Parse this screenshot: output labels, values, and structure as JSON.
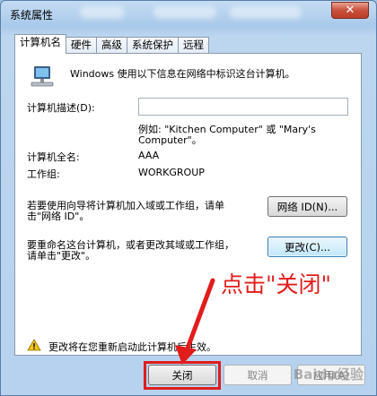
{
  "window": {
    "title": "系统属性",
    "close_glyph": "✕"
  },
  "tabs": [
    {
      "label": "计算机名",
      "active": true
    },
    {
      "label": "硬件"
    },
    {
      "label": "高级"
    },
    {
      "label": "系统保护"
    },
    {
      "label": "远程"
    }
  ],
  "panel": {
    "intro": "Windows 使用以下信息在网络中标识这台计算机。",
    "description_label": "计算机描述(D):",
    "description_value": "",
    "example_line1": "例如: \"Kitchen Computer\" 或 \"Mary's",
    "example_line2": "Computer\"。",
    "full_name_label": "计算机全名:",
    "full_name_value": "AAA",
    "workgroup_label": "工作组:",
    "workgroup_value": "WORKGROUP",
    "network_id_text_1": "若要使用向导将计算机加入域或工作组，请单",
    "network_id_text_2": "击\"网络 ID\"。",
    "network_id_button": "网络 ID(N)...",
    "change_text_1": "要重命名这台计算机，或者更改其域或工作组，",
    "change_text_2": "请单击\"更改\"。",
    "change_button": "更改(C)...",
    "warning_text": "更改将在您重新启动此计算机后生效。"
  },
  "buttons": {
    "close": "关闭",
    "cancel": "取消",
    "apply": "应用(A)"
  },
  "annotation": {
    "text": "点击\"关闭\"",
    "color": "#e21b1b"
  },
  "watermark": "Baidu经验"
}
